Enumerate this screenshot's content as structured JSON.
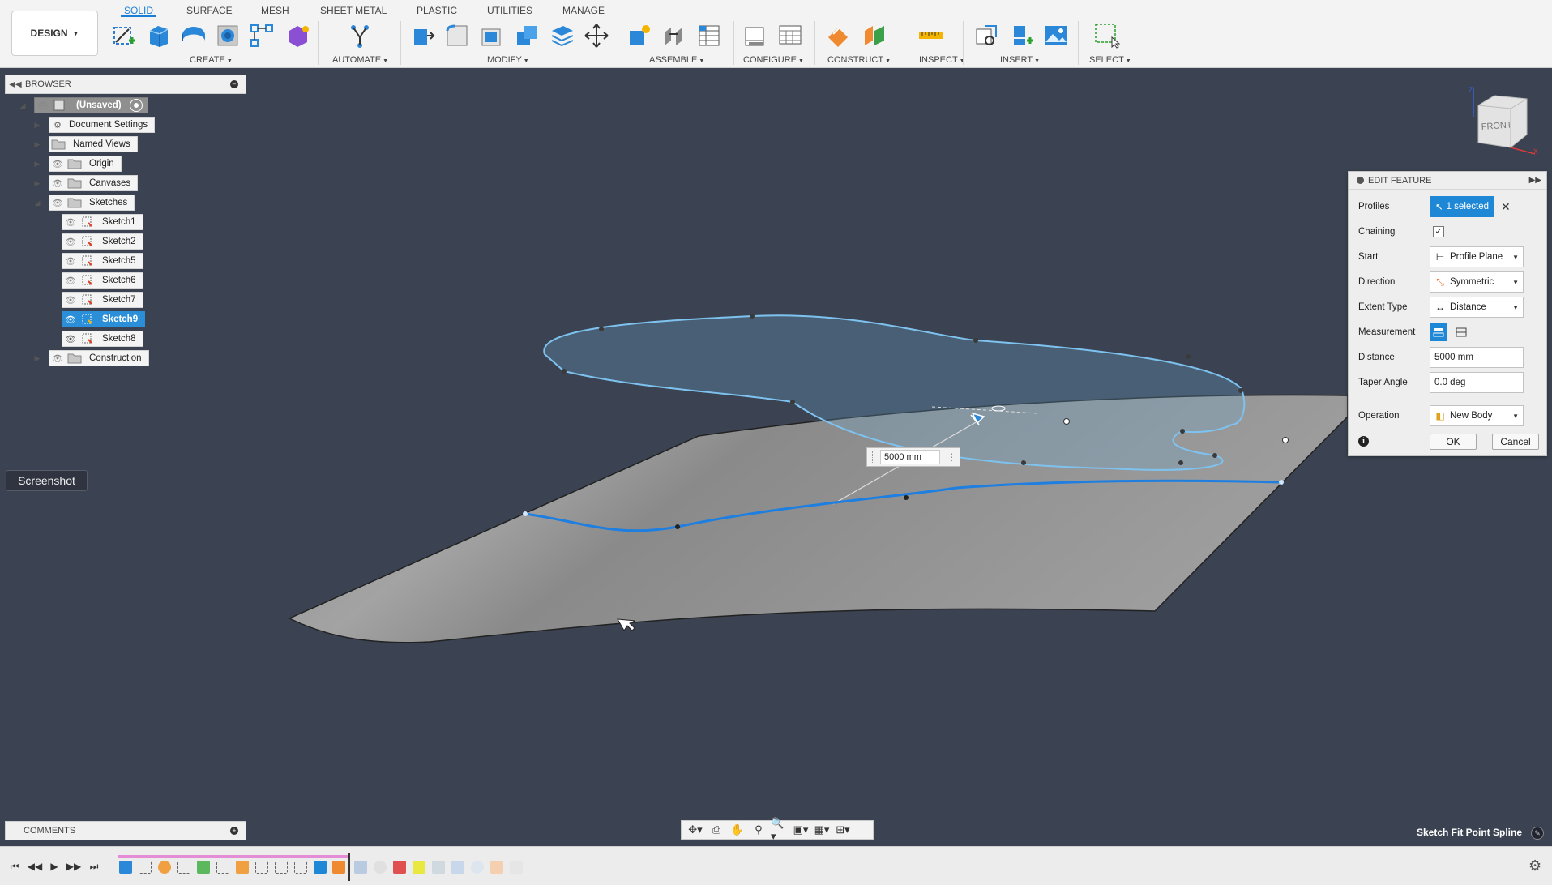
{
  "workspace": {
    "label": "DESIGN"
  },
  "tabs": [
    "SOLID",
    "SURFACE",
    "MESH",
    "SHEET METAL",
    "PLASTIC",
    "UTILITIES",
    "MANAGE"
  ],
  "tool_groups": [
    "CREATE",
    "AUTOMATE",
    "MODIFY",
    "ASSEMBLE",
    "CONFIGURE",
    "CONSTRUCT",
    "INSPECT",
    "INSERT",
    "SELECT"
  ],
  "browser": {
    "title": "BROWSER",
    "root": "(Unsaved)",
    "nodes": [
      "Document Settings",
      "Named Views",
      "Origin",
      "Canvases",
      "Sketches"
    ],
    "sketches": [
      "Sketch1",
      "Sketch2",
      "Sketch5",
      "Sketch6",
      "Sketch7",
      "Sketch9",
      "Sketch8"
    ],
    "construction": "Construction",
    "selected_sketch": "Sketch9"
  },
  "tooltip": {
    "text": "Screenshot"
  },
  "edit_feature": {
    "title": "EDIT FEATURE",
    "profiles_label": "Profiles",
    "profiles_value": "1 selected",
    "chaining_label": "Chaining",
    "chaining_checked": true,
    "start_label": "Start",
    "start_value": "Profile Plane",
    "direction_label": "Direction",
    "direction_value": "Symmetric",
    "extent_label": "Extent Type",
    "extent_value": "Distance",
    "measurement_label": "Measurement",
    "distance_label": "Distance",
    "distance_value": "5000 mm",
    "taper_label": "Taper Angle",
    "taper_value": "0.0 deg",
    "operation_label": "Operation",
    "operation_value": "New Body",
    "ok_label": "OK",
    "cancel_label": "Cancel"
  },
  "canvas_input": {
    "value": "5000 mm"
  },
  "viewcube": {
    "face": "FRONT",
    "axis_z": "Z",
    "axis_x": "X"
  },
  "comments": {
    "title": "COMMENTS"
  },
  "status": {
    "text": "Sketch Fit Point Spline"
  },
  "colors": {
    "accent": "#1e88d6",
    "background": "#3b4352",
    "surface": "#9a9a9a",
    "spline": "#1e7fe0",
    "profile_outline": "#7ec3f0"
  }
}
